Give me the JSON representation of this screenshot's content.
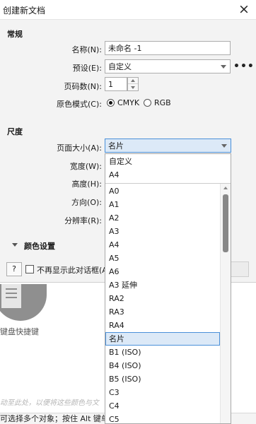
{
  "dialog": {
    "title": "创建新文档",
    "sections": {
      "general": "常规",
      "dimensions": "尺度",
      "color_settings": "颜色设置"
    },
    "fields": {
      "name_label": "名称(N):",
      "name_value": "未命名 -1",
      "preset_label": "预设(E):",
      "preset_value": "自定义",
      "pages_label": "页码数(N):",
      "pages_value": "1",
      "color_mode_label": "原色模式(C):",
      "color_mode_cmyk": "CMYK",
      "color_mode_rgb": "RGB",
      "color_mode_selected": "CMYK",
      "page_size_label": "页面大小(A):",
      "page_size_value": "名片",
      "width_label": "宽度(W):",
      "height_label": "高度(H):",
      "orientation_label": "方向(O):",
      "resolution_label": "分辨率(R):"
    },
    "more_icon_text": "•••",
    "help_button": "?",
    "dont_show_label": "不再显示此对话框(A",
    "close_glyph": "×"
  },
  "dropdown": {
    "top_items": [
      "自定义",
      "A4"
    ],
    "items": [
      "A0",
      "A1",
      "A2",
      "A3",
      "A4",
      "A5",
      "A6",
      "A3 延伸",
      "RA2",
      "RA3",
      "RA4",
      "名片",
      "B1 (ISO)",
      "B4 (ISO)",
      "B5 (ISO)",
      "C3",
      "C4",
      "C5"
    ],
    "selected": "名片"
  },
  "background": {
    "keyboard_shortcuts": "键盘快捷键",
    "hint": "动至此处，以便将这些颜色与文",
    "status": "可选择多个对象；按住 Alt 键单"
  },
  "colors": {
    "accent": "#4a90d9",
    "selected_bg": "#dce9f7",
    "dialog_bg": "#f3f3f3"
  }
}
